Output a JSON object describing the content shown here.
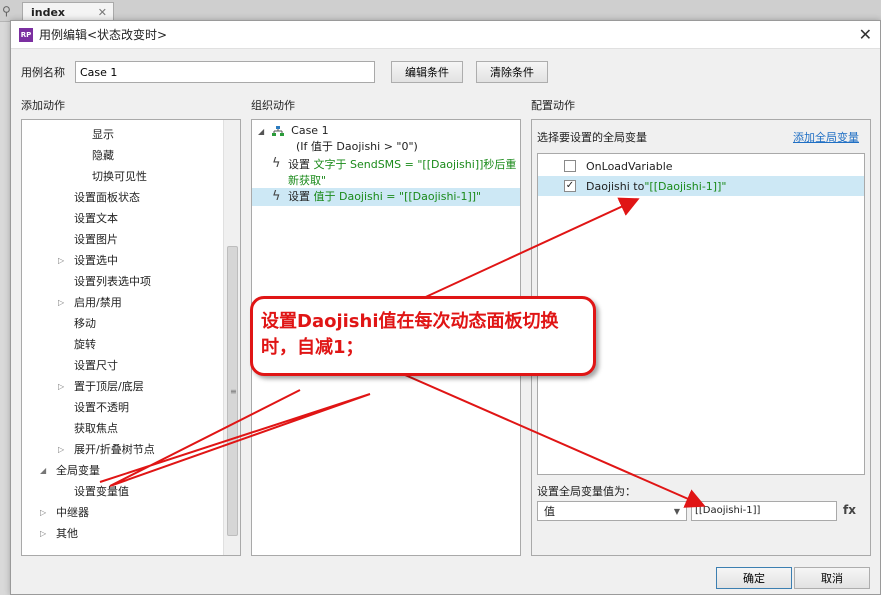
{
  "background": {
    "tab_label": "index",
    "tab_close": "✕",
    "left_icon": "search-icon"
  },
  "dialog": {
    "title": "用例编辑<状态改变时>",
    "app_icon_text": "RP",
    "close": "✕"
  },
  "case_name": {
    "label": "用例名称",
    "value": "Case 1"
  },
  "buttons": {
    "edit_condition": "编辑条件",
    "clear_condition": "清除条件",
    "ok": "确定",
    "cancel": "取消"
  },
  "sections": {
    "add_action": "添加动作",
    "organize_action": "组织动作",
    "configure_action": "配置动作"
  },
  "left_tree": [
    {
      "label": "显示",
      "level": 2
    },
    {
      "label": "隐藏",
      "level": 2
    },
    {
      "label": "切换可见性",
      "level": 2
    },
    {
      "label": "设置面板状态",
      "level": 1
    },
    {
      "label": "设置文本",
      "level": 1
    },
    {
      "label": "设置图片",
      "level": 1
    },
    {
      "label": "设置选中",
      "level": 1,
      "arrow": "▷"
    },
    {
      "label": "设置列表选中项",
      "level": 1
    },
    {
      "label": "启用/禁用",
      "level": 1,
      "arrow": "▷"
    },
    {
      "label": "移动",
      "level": 1
    },
    {
      "label": "旋转",
      "level": 1
    },
    {
      "label": "设置尺寸",
      "level": 1
    },
    {
      "label": "置于顶层/底层",
      "level": 1,
      "arrow": "▷"
    },
    {
      "label": "设置不透明",
      "level": 1
    },
    {
      "label": "获取焦点",
      "level": 1
    },
    {
      "label": "展开/折叠树节点",
      "level": 1,
      "arrow": "▷"
    },
    {
      "label": "全局变量",
      "level": 0,
      "arrow": "◢"
    },
    {
      "label": "设置变量值",
      "level": 1
    },
    {
      "label": "中继器",
      "level": 0,
      "arrow": "▷"
    },
    {
      "label": "其他",
      "level": 0,
      "arrow": "▷"
    }
  ],
  "middle": {
    "case_title": "Case 1",
    "case_condition": "(If 值于 Daojishi > \"0\")",
    "actions": [
      {
        "prefix": "设置 ",
        "detail": "文字于 SendSMS = \"[[Daojishi]]秒后重新获取\""
      },
      {
        "prefix": "设置 ",
        "detail": "值于 Daojishi = \"[[Daojishi-1]]\""
      }
    ]
  },
  "right": {
    "select_vars_label": "选择要设置的全局变量",
    "add_var_link": "添加全局变量",
    "variables": [
      {
        "name": "OnLoadVariable",
        "suffix": "",
        "checked": false
      },
      {
        "name": "Daojishi to ",
        "suffix": "\"[[Daojishi-1]]\"",
        "checked": true
      }
    ],
    "set_value_label": "设置全局变量值为：",
    "value_type": "值",
    "value_expr": "[[Daojishi-1]]",
    "fx": "fx"
  },
  "annotation": {
    "text": "设置Daojishi值在每次动态面板切换时，自减1；",
    "color": "#e01515"
  },
  "colors": {
    "selection": "#cde8f5",
    "green_text": "#1a8a1a",
    "link": "#1f6fc4"
  }
}
